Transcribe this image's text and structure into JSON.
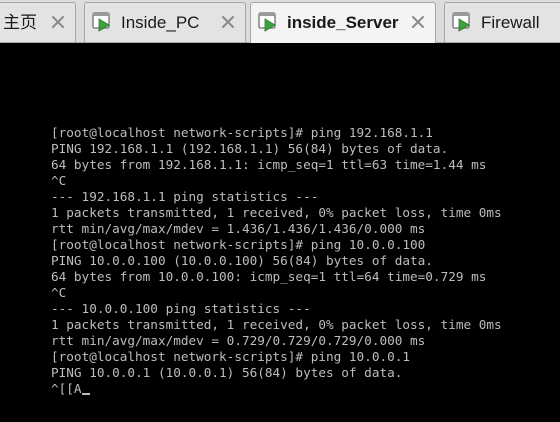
{
  "tabs": [
    {
      "label": "主页",
      "active": false,
      "icon": "home-icon"
    },
    {
      "label": "Inside_PC",
      "active": false,
      "icon": "vm-icon"
    },
    {
      "label": "inside_Server",
      "active": true,
      "icon": "vm-icon"
    },
    {
      "label": "Firewall",
      "active": false,
      "icon": "vm-icon"
    }
  ],
  "colors": {
    "terminal_bg": "#000000",
    "terminal_fg": "#bdbdbd",
    "vm_icon_green": "#3ea33e"
  },
  "terminal": {
    "lines": [
      "[root@localhost network-scripts]# ping 192.168.1.1",
      "PING 192.168.1.1 (192.168.1.1) 56(84) bytes of data.",
      "64 bytes from 192.168.1.1: icmp_seq=1 ttl=63 time=1.44 ms",
      "^C",
      "--- 192.168.1.1 ping statistics ---",
      "1 packets transmitted, 1 received, 0% packet loss, time 0ms",
      "rtt min/avg/max/mdev = 1.436/1.436/1.436/0.000 ms",
      "[root@localhost network-scripts]# ping 10.0.0.100",
      "PING 10.0.0.100 (10.0.0.100) 56(84) bytes of data.",
      "64 bytes from 10.0.0.100: icmp_seq=1 ttl=64 time=0.729 ms",
      "^C",
      "--- 10.0.0.100 ping statistics ---",
      "1 packets transmitted, 1 received, 0% packet loss, time 0ms",
      "rtt min/avg/max/mdev = 0.729/0.729/0.729/0.000 ms",
      "[root@localhost network-scripts]# ping 10.0.0.1",
      "PING 10.0.0.1 (10.0.0.1) 56(84) bytes of data.",
      "^[[A"
    ]
  }
}
